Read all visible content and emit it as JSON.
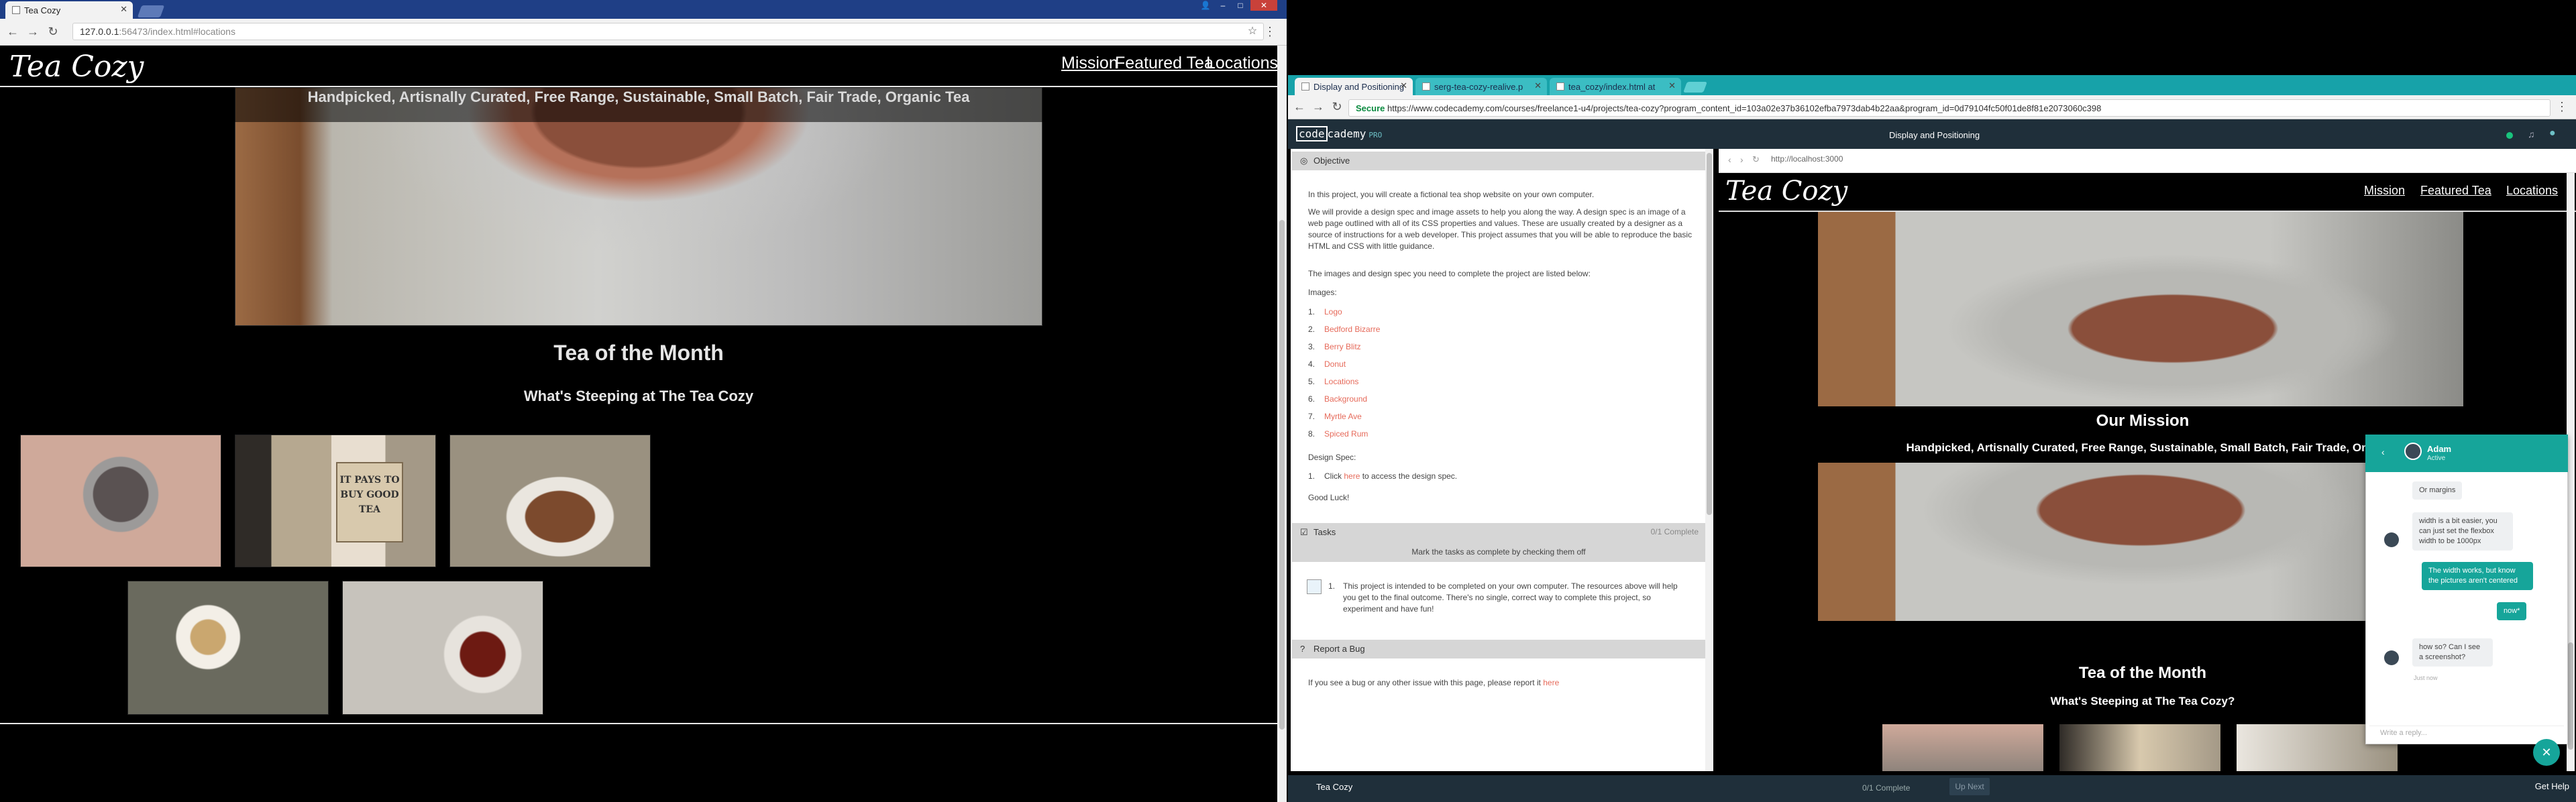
{
  "left_window": {
    "tab_title": "Tea Cozy",
    "url_host": "127.0.0.1",
    "url_rest": ":56473/index.html#locations",
    "logo": "Tea Cozy",
    "nav": [
      "Mission",
      "Featured Tea",
      "Locations"
    ],
    "tagline": "Handpicked, Artisnally Curated, Free Range, Sustainable, Small Batch, Fair Trade, Organic Tea",
    "tea_heading": "Tea of the Month",
    "tea_subheading": "What's Steeping at The Tea Cozy",
    "box_text": "IT PAYS TO BUY GOOD TEA"
  },
  "right_window": {
    "tabs": [
      "Display and Positioning",
      "serg-tea-cozy-realive.p",
      "tea_cozy/index.html at"
    ],
    "secure_label": "Secure",
    "url": "https://www.codecademy.com/courses/freelance1-u4/projects/tea-cozy?program_content_id=103a02e37b36102efba7973dab4b22aa&program_id=0d79104fc50f01de8f81e2073060c398",
    "brand_code": "code",
    "brand_rest": "cademy",
    "brand_pro": "PRO",
    "lesson_title": "Display and Positioning",
    "objective_header": "Objective",
    "objective_p1": "In this project, you will create a fictional tea shop website on your own computer.",
    "objective_p2": "We will provide a design spec and image assets to help you along the way. A design spec is an image of a web page outlined with all of its CSS properties and values. These are usually created by a designer as a source of instructions for a web developer. This project assumes that you will be able to reproduce the basic HTML and CSS with little guidance.",
    "objective_p3": "The images and design spec you need to complete the project are listed below:",
    "images_label": "Images:",
    "images": [
      "Logo",
      "Bedford Bizarre",
      "Berry Blitz",
      "Donut",
      "Locations",
      "Background",
      "Myrtle Ave",
      "Spiced Rum"
    ],
    "design_spec_label": "Design Spec:",
    "design_spec_item_prefix": "Click",
    "design_spec_link": "here",
    "design_spec_item_suffix": "to access the design spec.",
    "good_luck": "Good Luck!",
    "tasks_header": "Tasks",
    "tasks_count": "0/1 Complete",
    "tasks_instruction": "Mark the tasks as complete by checking them off",
    "task_number": "1.",
    "task_text": "This project is intended to be completed on your own computer. The resources above will help you get to the final outcome. There's no single, correct way to complete this project, so experiment and have fun!",
    "bug_header": "Report a Bug",
    "bug_text": "If you see a bug or any other issue with this page, please report it",
    "bug_link": "here",
    "embedded_url": "http://localhost:3000",
    "embedded_logo": "Tea Cozy",
    "embedded_nav": [
      "Mission",
      "Featured Tea",
      "Locations"
    ],
    "mission_heading": "Our Mission",
    "mission_tagline": "Handpicked, Artisnally Curated, Free Range, Sustainable, Small Batch, Fair Trade, Orga",
    "tea_heading": "Tea of the Month",
    "tea_subheading": "What's Steeping at The Tea Cozy?",
    "bottom_title": "Tea Cozy",
    "bottom_complete": "0/1 Complete",
    "next_label": "Up Next",
    "help_label": "Get Help"
  },
  "chat": {
    "name": "Adam",
    "status": "Active",
    "messages": [
      {
        "from": "in",
        "text": "Or margins"
      },
      {
        "from": "in",
        "text": "width is a bit easier, you can just set the flexbox width to be 1000px"
      },
      {
        "from": "out",
        "text": "The width works, but know the pictures aren't centered"
      },
      {
        "from": "out",
        "text": "now*"
      },
      {
        "from": "in",
        "text": "how so? Can I see a screenshot?"
      }
    ],
    "timestamp": "Just now",
    "input_placeholder": "Write a reply..."
  },
  "colors": {
    "teal": "#16a59a",
    "link_red": "#e66a5a",
    "cc_dark": "#1f2f3a"
  }
}
